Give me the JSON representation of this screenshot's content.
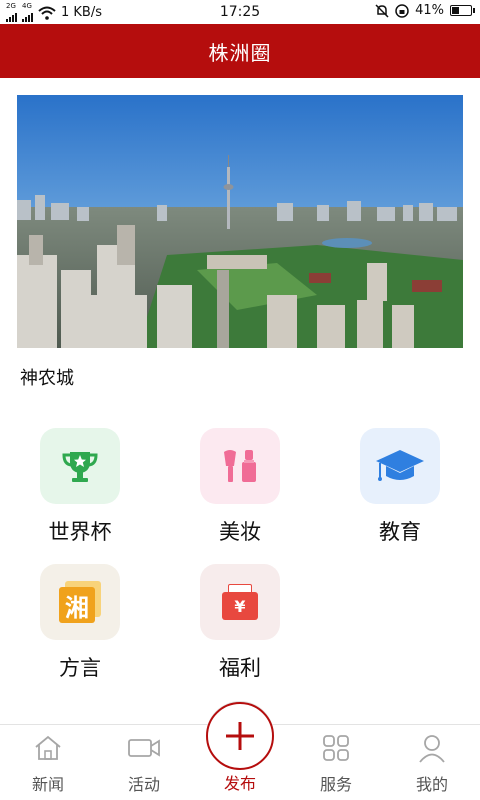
{
  "status_bar": {
    "left_tags": [
      "2G",
      "4G"
    ],
    "network_speed": "1 KB/s",
    "time": "17:25",
    "battery": "41%",
    "battery_level": 0.41
  },
  "header": {
    "title": "株洲圈"
  },
  "banner": {
    "caption": "神农城"
  },
  "categories": [
    {
      "label": "世界杯",
      "icon": "trophy-icon",
      "bg": "#e6f6ea",
      "color": "#2fa84f"
    },
    {
      "label": "美妆",
      "icon": "makeup-icon",
      "bg": "#fce9f0",
      "color": "#f06c96"
    },
    {
      "label": "教育",
      "icon": "graduation-cap-icon",
      "bg": "#e7f0fc",
      "color": "#2f7fe0"
    },
    {
      "label": "方言",
      "icon": "dialect-icon",
      "bg": "#f4f0e8",
      "color": "#f0a21c",
      "glyph": "湘"
    },
    {
      "label": "福利",
      "icon": "red-envelope-icon",
      "bg": "#f7ecec",
      "color": "#e8483f",
      "glyph": "¥"
    }
  ],
  "bottom_nav": {
    "items": [
      {
        "label": "新闻",
        "icon": "home-icon"
      },
      {
        "label": "活动",
        "icon": "video-icon"
      },
      {
        "label": "服务",
        "icon": "grid-icon"
      },
      {
        "label": "我的",
        "icon": "user-icon"
      }
    ],
    "publish": {
      "label": "发布",
      "icon": "plus-icon"
    }
  },
  "colors": {
    "brand": "#b50d0d"
  }
}
